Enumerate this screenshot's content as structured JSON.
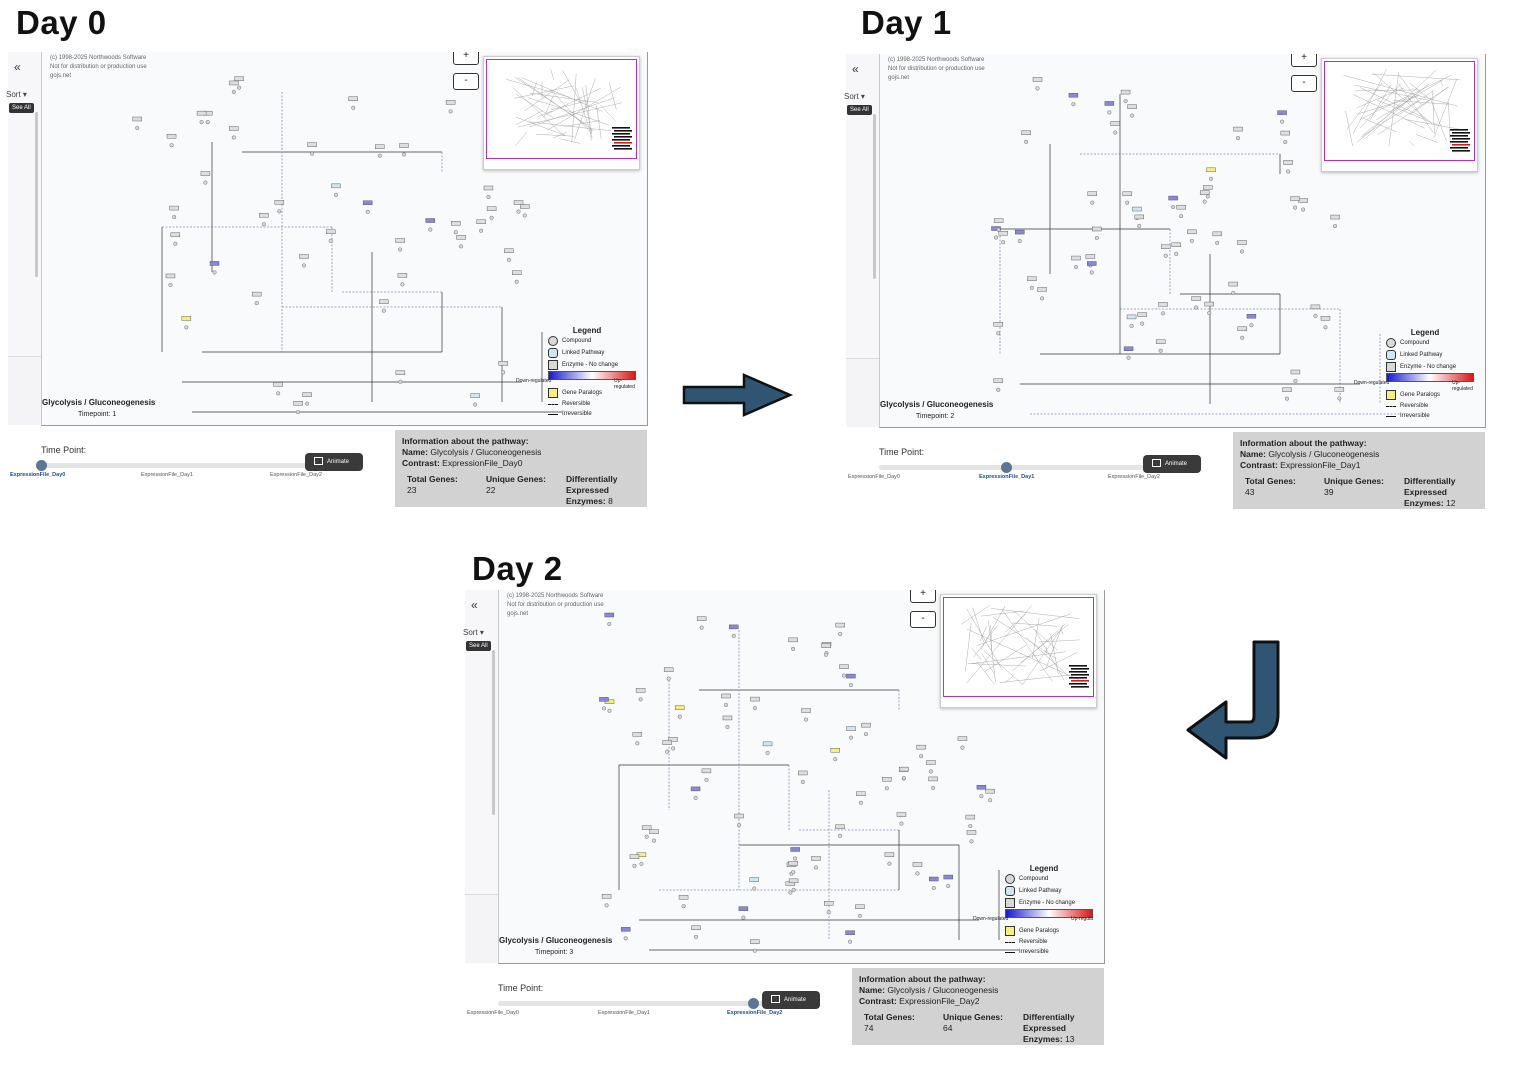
{
  "panels": [
    {
      "title": "Day 0",
      "copyright": [
        "(c) 1998-2025 Northwoods Software",
        "Not for distribution or production use",
        "gojs.net"
      ],
      "sidebar": {
        "collapse": "«",
        "sort": "Sort",
        "see_all": "See All"
      },
      "zoom_in": "+",
      "zoom_out": "-",
      "legend": {
        "title": "Legend",
        "compound": "Compound",
        "linked": "Linked Pathway",
        "enzyme": "Enzyme - No change",
        "down": "Down-regulated",
        "up": "Up-regulated",
        "paralogs": "Gene Paralogs",
        "reversible": "Reversible",
        "irreversible": "Irreversible"
      },
      "pathway_name": "Glycolysis / Gluconeogenesis",
      "timepoint": "Timepoint: 1",
      "time_point_label": "Time Point:",
      "slider_options": [
        "ExpressionFile_Day0",
        "ExpressionFile_Day1",
        "ExpressionFile_Day2"
      ],
      "slider_selected_index": 0,
      "animate_label": "Animate",
      "info": {
        "heading": "Information about the pathway:",
        "name_label": "Name:",
        "name": "Glycolysis / Gluconeogenesis",
        "contrast_label": "Contrast:",
        "contrast": "ExpressionFile_Day0",
        "total_label": "Total Genes:",
        "total": "23",
        "unique_label": "Unique Genes:",
        "unique": "22",
        "de_label_1": "Differentially",
        "de_label_2": "Expressed",
        "de_label_3": "Enzymes:",
        "de": "8"
      }
    },
    {
      "title": "Day 1",
      "copyright": [
        "(c) 1998-2025 Northwoods Software",
        "Not for distribution or production use",
        "gojs.net"
      ],
      "sidebar": {
        "collapse": "«",
        "sort": "Sort",
        "see_all": "See All"
      },
      "zoom_in": "+",
      "zoom_out": "-",
      "legend": {
        "title": "Legend",
        "compound": "Compound",
        "linked": "Linked Pathway",
        "enzyme": "Enzyme - No change",
        "down": "Down-regulated",
        "up": "Up-regulated",
        "paralogs": "Gene Paralogs",
        "reversible": "Reversible",
        "irreversible": "Irreversible"
      },
      "pathway_name": "Glycolysis / Gluconeogenesis",
      "timepoint": "Timepoint: 2",
      "time_point_label": "Time Point:",
      "slider_options": [
        "ExpressionFile_Day0",
        "ExpressionFile_Day1",
        "ExpressionFile_Day2"
      ],
      "slider_selected_index": 1,
      "animate_label": "Animate",
      "info": {
        "heading": "Information about the pathway:",
        "name_label": "Name:",
        "name": "Glycolysis / Gluconeogenesis",
        "contrast_label": "Contrast:",
        "contrast": "ExpressionFile_Day1",
        "total_label": "Total Genes:",
        "total": "43",
        "unique_label": "Unique Genes:",
        "unique": "39",
        "de_label_1": "Differentially",
        "de_label_2": "Expressed",
        "de_label_3": "Enzymes:",
        "de": "12"
      }
    },
    {
      "title": "Day 2",
      "copyright": [
        "(c) 1998-2025 Northwoods Software",
        "Not for distribution or production use",
        "gojs.net"
      ],
      "sidebar": {
        "collapse": "«",
        "sort": "Sort",
        "see_all": "See All"
      },
      "zoom_in": "+",
      "zoom_out": "-",
      "legend": {
        "title": "Legend",
        "compound": "Compound",
        "linked": "Linked Pathway",
        "enzyme": "Enzyme - No change",
        "down": "Down-regulated",
        "up": "Up-regula",
        "paralogs": "Gene Paralogs",
        "reversible": "Reversible",
        "irreversible": "Irreversible"
      },
      "pathway_name": "Glycolysis / Gluconeogenesis",
      "timepoint": "Timepoint: 3",
      "time_point_label": "Time Point:",
      "slider_options": [
        "ExpressionFile_Day0",
        "ExpressionFile_Day1",
        "ExpressionFile_Day2"
      ],
      "slider_selected_index": 2,
      "animate_label": "Animate",
      "info": {
        "heading": "Information about the pathway:",
        "name_label": "Name:",
        "name": "Glycolysis / Gluconeogenesis",
        "contrast_label": "Contrast:",
        "contrast": "ExpressionFile_Day2",
        "total_label": "Total Genes:",
        "total": "74",
        "unique_label": "Unique Genes:",
        "unique": "64",
        "de_label_1": "Differentially",
        "de_label_2": "Expressed",
        "de_label_3": "Enzymes:",
        "de": "13"
      }
    }
  ],
  "colors": {
    "arrow_fill": "#2f5573",
    "arrow_stroke": "#111111",
    "overview_border": "#b52fc9",
    "enzyme_up_blue": "#8a86e0",
    "paralog_yellow": "#f6ef7a",
    "linked_blue": "#cfe7f0"
  },
  "icons": [
    "expand-icon",
    "forward-arrow",
    "return-arrow",
    "video-icon"
  ]
}
